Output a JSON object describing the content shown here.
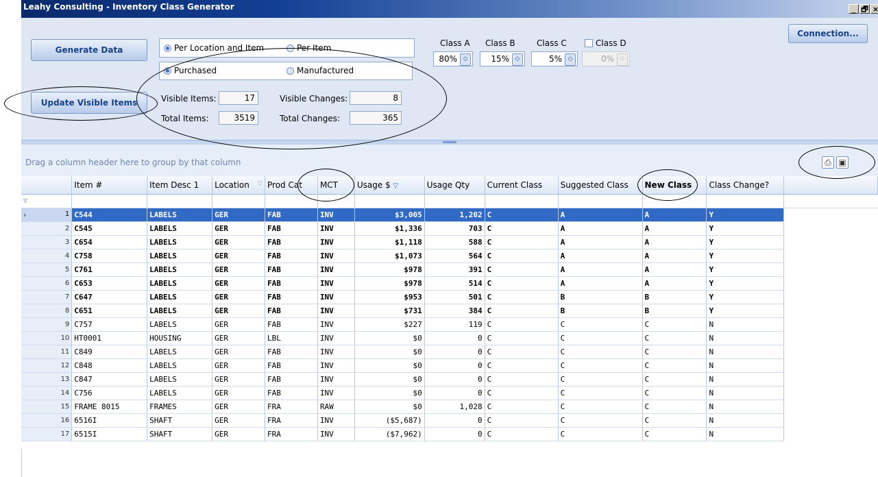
{
  "window": {
    "title": "Leahy Consulting - Inventory Class Generator",
    "minimize": "_",
    "restore": "🗗",
    "close": "×"
  },
  "toolbar": {
    "generate_label": "Generate Data",
    "update_label": "Update Visible Items",
    "connection_label": "Connection...",
    "scope_options": [
      {
        "label": "Per Location and Item",
        "selected": true
      },
      {
        "label": "Per Item",
        "selected": false
      }
    ],
    "source_options": [
      {
        "label": "Purchased",
        "selected": true
      },
      {
        "label": "Manufactured",
        "selected": false
      }
    ],
    "stats": {
      "visible_items_label": "Visible Items:",
      "visible_items": "17",
      "visible_changes_label": "Visible Changes:",
      "visible_changes": "8",
      "total_items_label": "Total Items:",
      "total_items": "3519",
      "total_changes_label": "Total Changes:",
      "total_changes": "365"
    },
    "classes": [
      {
        "label": "Class A",
        "value": "80%",
        "enabled": true
      },
      {
        "label": "Class B",
        "value": "15%",
        "enabled": true
      },
      {
        "label": "Class C",
        "value": "5%",
        "enabled": true
      },
      {
        "label": "Class D",
        "value": "0%",
        "enabled": false
      }
    ]
  },
  "grid": {
    "group_hint": "Drag a column header here to group by that column",
    "columns": [
      "Item #",
      "Item Desc 1",
      "Location",
      "Prod Cat",
      "MCT",
      "Usage $",
      "Usage Qty",
      "Current Class",
      "Suggested Class",
      "New Class",
      "Class Change?"
    ],
    "rows": [
      [
        "1",
        "C544",
        "LABELS",
        "GER",
        "FAB",
        "INV",
        "$3,005",
        "1,202",
        "C",
        "A",
        "A",
        "Y"
      ],
      [
        "2",
        "C545",
        "LABELS",
        "GER",
        "FAB",
        "INV",
        "$1,336",
        "703",
        "C",
        "A",
        "A",
        "Y"
      ],
      [
        "3",
        "C654",
        "LABELS",
        "GER",
        "FAB",
        "INV",
        "$1,118",
        "588",
        "C",
        "A",
        "A",
        "Y"
      ],
      [
        "4",
        "C758",
        "LABELS",
        "GER",
        "FAB",
        "INV",
        "$1,073",
        "564",
        "C",
        "A",
        "A",
        "Y"
      ],
      [
        "5",
        "C761",
        "LABELS",
        "GER",
        "FAB",
        "INV",
        "$978",
        "391",
        "C",
        "A",
        "A",
        "Y"
      ],
      [
        "6",
        "C653",
        "LABELS",
        "GER",
        "FAB",
        "INV",
        "$978",
        "514",
        "C",
        "A",
        "A",
        "Y"
      ],
      [
        "7",
        "C647",
        "LABELS",
        "GER",
        "FAB",
        "INV",
        "$953",
        "501",
        "C",
        "B",
        "B",
        "Y"
      ],
      [
        "8",
        "C651",
        "LABELS",
        "GER",
        "FAB",
        "INV",
        "$731",
        "384",
        "C",
        "B",
        "B",
        "Y"
      ],
      [
        "9",
        "C757",
        "LABELS",
        "GER",
        "FAB",
        "INV",
        "$227",
        "119",
        "C",
        "C",
        "C",
        "N"
      ],
      [
        "10",
        "HT0001",
        "HOUSING",
        "GER",
        "LBL",
        "INV",
        "$0",
        "0",
        "C",
        "C",
        "C",
        "N"
      ],
      [
        "11",
        "C849",
        "LABELS",
        "GER",
        "FAB",
        "INV",
        "$0",
        "0",
        "C",
        "C",
        "C",
        "N"
      ],
      [
        "12",
        "C848",
        "LABELS",
        "GER",
        "FAB",
        "INV",
        "$0",
        "0",
        "C",
        "C",
        "C",
        "N"
      ],
      [
        "13",
        "C847",
        "LABELS",
        "GER",
        "FAB",
        "INV",
        "$0",
        "0",
        "C",
        "C",
        "C",
        "N"
      ],
      [
        "14",
        "C756",
        "LABELS",
        "GER",
        "FAB",
        "INV",
        "$0",
        "0",
        "C",
        "C",
        "C",
        "N"
      ],
      [
        "15",
        "FRAME 8015",
        "FRAMES",
        "GER",
        "FRA",
        "RAW",
        "$0",
        "1,028",
        "C",
        "C",
        "C",
        "N"
      ],
      [
        "16",
        "6516I",
        "SHAFT",
        "GER",
        "FRA",
        "INV",
        "($5,687)",
        "0",
        "C",
        "C",
        "C",
        "N"
      ],
      [
        "17",
        "6515I",
        "SHAFT",
        "GER",
        "FRA",
        "INV",
        "($7,962)",
        "0",
        "C",
        "C",
        "C",
        "N"
      ]
    ],
    "bold_rows": 8,
    "selected_row": 1
  }
}
